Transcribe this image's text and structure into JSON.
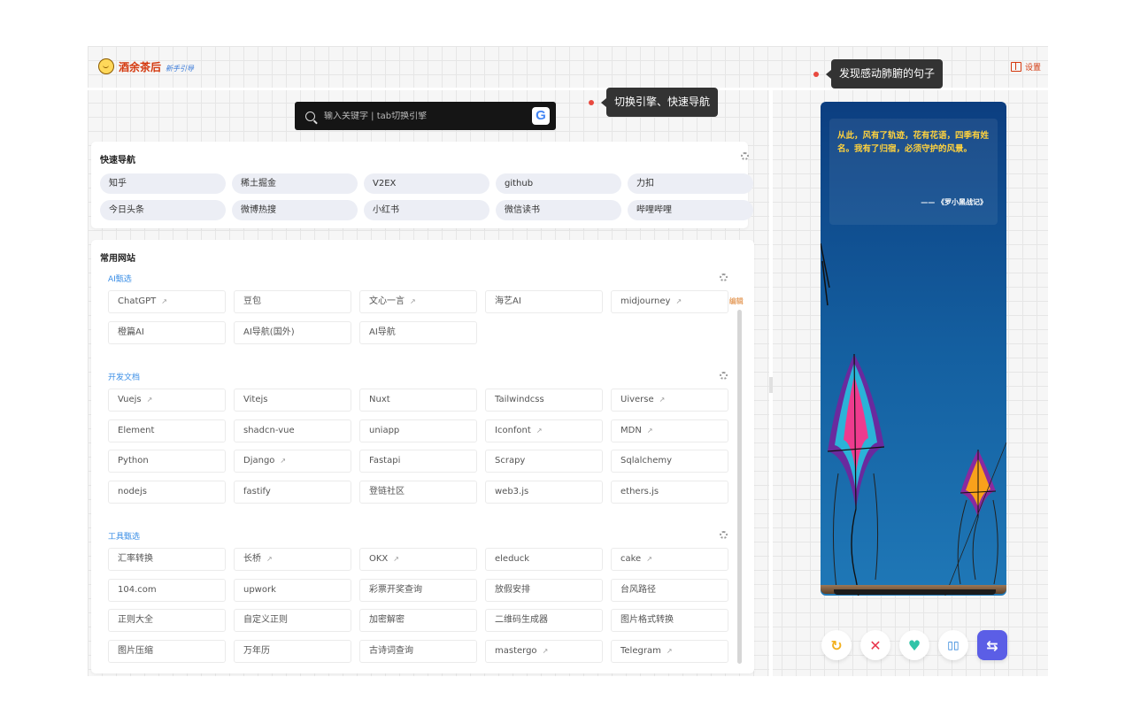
{
  "header": {
    "app_title": "酒余茶后",
    "guide_link": "新手引导",
    "settings_label": "设置"
  },
  "tooltips": {
    "quote_tip": "发现感动肺腑的句子",
    "engine_tip": "切换引擎、快速导航"
  },
  "search": {
    "placeholder": "输入关键字 | tab切换引擎",
    "engine_icon": "google-icon",
    "engine_letter": "G"
  },
  "quick_nav": {
    "title": "快速导航",
    "items": [
      "知乎",
      "稀土掘金",
      "V2EX",
      "github",
      "力扣",
      "今日头条",
      "微博热搜",
      "小红书",
      "微信读书",
      "哔哩哔哩"
    ]
  },
  "common_sites": {
    "title": "常用网站",
    "json_edit_label": "✎ JSON编辑",
    "sections": [
      {
        "title": "AI甄选",
        "items": [
          {
            "label": "ChatGPT",
            "ext": "↗"
          },
          {
            "label": "豆包",
            "ext": ""
          },
          {
            "label": "文心一言",
            "ext": "↗"
          },
          {
            "label": "海艺AI",
            "ext": ""
          },
          {
            "label": "midjourney",
            "ext": "↗"
          },
          {
            "label": "橙篇AI",
            "ext": ""
          },
          {
            "label": "AI导航(国外)",
            "ext": ""
          },
          {
            "label": "AI导航",
            "ext": ""
          }
        ]
      },
      {
        "title": "开发文档",
        "items": [
          {
            "label": "Vuejs",
            "ext": "↗"
          },
          {
            "label": "Vitejs",
            "ext": ""
          },
          {
            "label": "Nuxt",
            "ext": ""
          },
          {
            "label": "Tailwindcss",
            "ext": ""
          },
          {
            "label": "Uiverse",
            "ext": "↗"
          },
          {
            "label": "Element",
            "ext": ""
          },
          {
            "label": "shadcn-vue",
            "ext": ""
          },
          {
            "label": "uniapp",
            "ext": ""
          },
          {
            "label": "Iconfont",
            "ext": "↗"
          },
          {
            "label": "MDN",
            "ext": "↗"
          },
          {
            "label": "Python",
            "ext": ""
          },
          {
            "label": "Django",
            "ext": "↗"
          },
          {
            "label": "Fastapi",
            "ext": ""
          },
          {
            "label": "Scrapy",
            "ext": ""
          },
          {
            "label": "Sqlalchemy",
            "ext": ""
          },
          {
            "label": "nodejs",
            "ext": ""
          },
          {
            "label": "fastify",
            "ext": ""
          },
          {
            "label": "登链社区",
            "ext": ""
          },
          {
            "label": "web3.js",
            "ext": ""
          },
          {
            "label": "ethers.js",
            "ext": ""
          }
        ]
      },
      {
        "title": "工具甄选",
        "items": [
          {
            "label": "汇率转换",
            "ext": ""
          },
          {
            "label": "长桥",
            "ext": "↗"
          },
          {
            "label": "OKX",
            "ext": "↗"
          },
          {
            "label": "eleduck",
            "ext": ""
          },
          {
            "label": "cake",
            "ext": "↗"
          },
          {
            "label": "104.com",
            "ext": ""
          },
          {
            "label": "upwork",
            "ext": ""
          },
          {
            "label": "彩票开奖查询",
            "ext": ""
          },
          {
            "label": "放假安排",
            "ext": ""
          },
          {
            "label": "台风路径",
            "ext": ""
          },
          {
            "label": "正则大全",
            "ext": ""
          },
          {
            "label": "自定义正则",
            "ext": ""
          },
          {
            "label": "加密解密",
            "ext": ""
          },
          {
            "label": "二维码生成器",
            "ext": ""
          },
          {
            "label": "图片格式转换",
            "ext": ""
          },
          {
            "label": "图片压缩",
            "ext": ""
          },
          {
            "label": "万年历",
            "ext": ""
          },
          {
            "label": "古诗词查询",
            "ext": ""
          },
          {
            "label": "mastergo",
            "ext": "↗"
          },
          {
            "label": "Telegram",
            "ext": "↗"
          }
        ]
      }
    ]
  },
  "quote": {
    "text": "从此，风有了轨迹，花有花语，四季有姓名。我有了归宿，必须守护的风景。",
    "source": "—— 《罗小黑战记》"
  },
  "actions": [
    {
      "name": "refresh-button",
      "icon": "refresh-icon",
      "glyph": "↻",
      "color": "#f2b01e"
    },
    {
      "name": "dislike-button",
      "icon": "close-icon",
      "glyph": "✕",
      "color": "#e8334a"
    },
    {
      "name": "like-button",
      "icon": "heart-icon",
      "glyph": "♥",
      "color": "#2fc4a8"
    },
    {
      "name": "reader-button",
      "icon": "book-icon",
      "glyph": "▯▯",
      "color": "#1c7ad8"
    },
    {
      "name": "switch-button",
      "icon": "switch-icon",
      "glyph": "⇆",
      "color": "#5b5ee6"
    }
  ],
  "colors": {
    "accent": "#d4380d",
    "section_title": "#3a8ee6",
    "quote_text": "#ffd23d"
  }
}
